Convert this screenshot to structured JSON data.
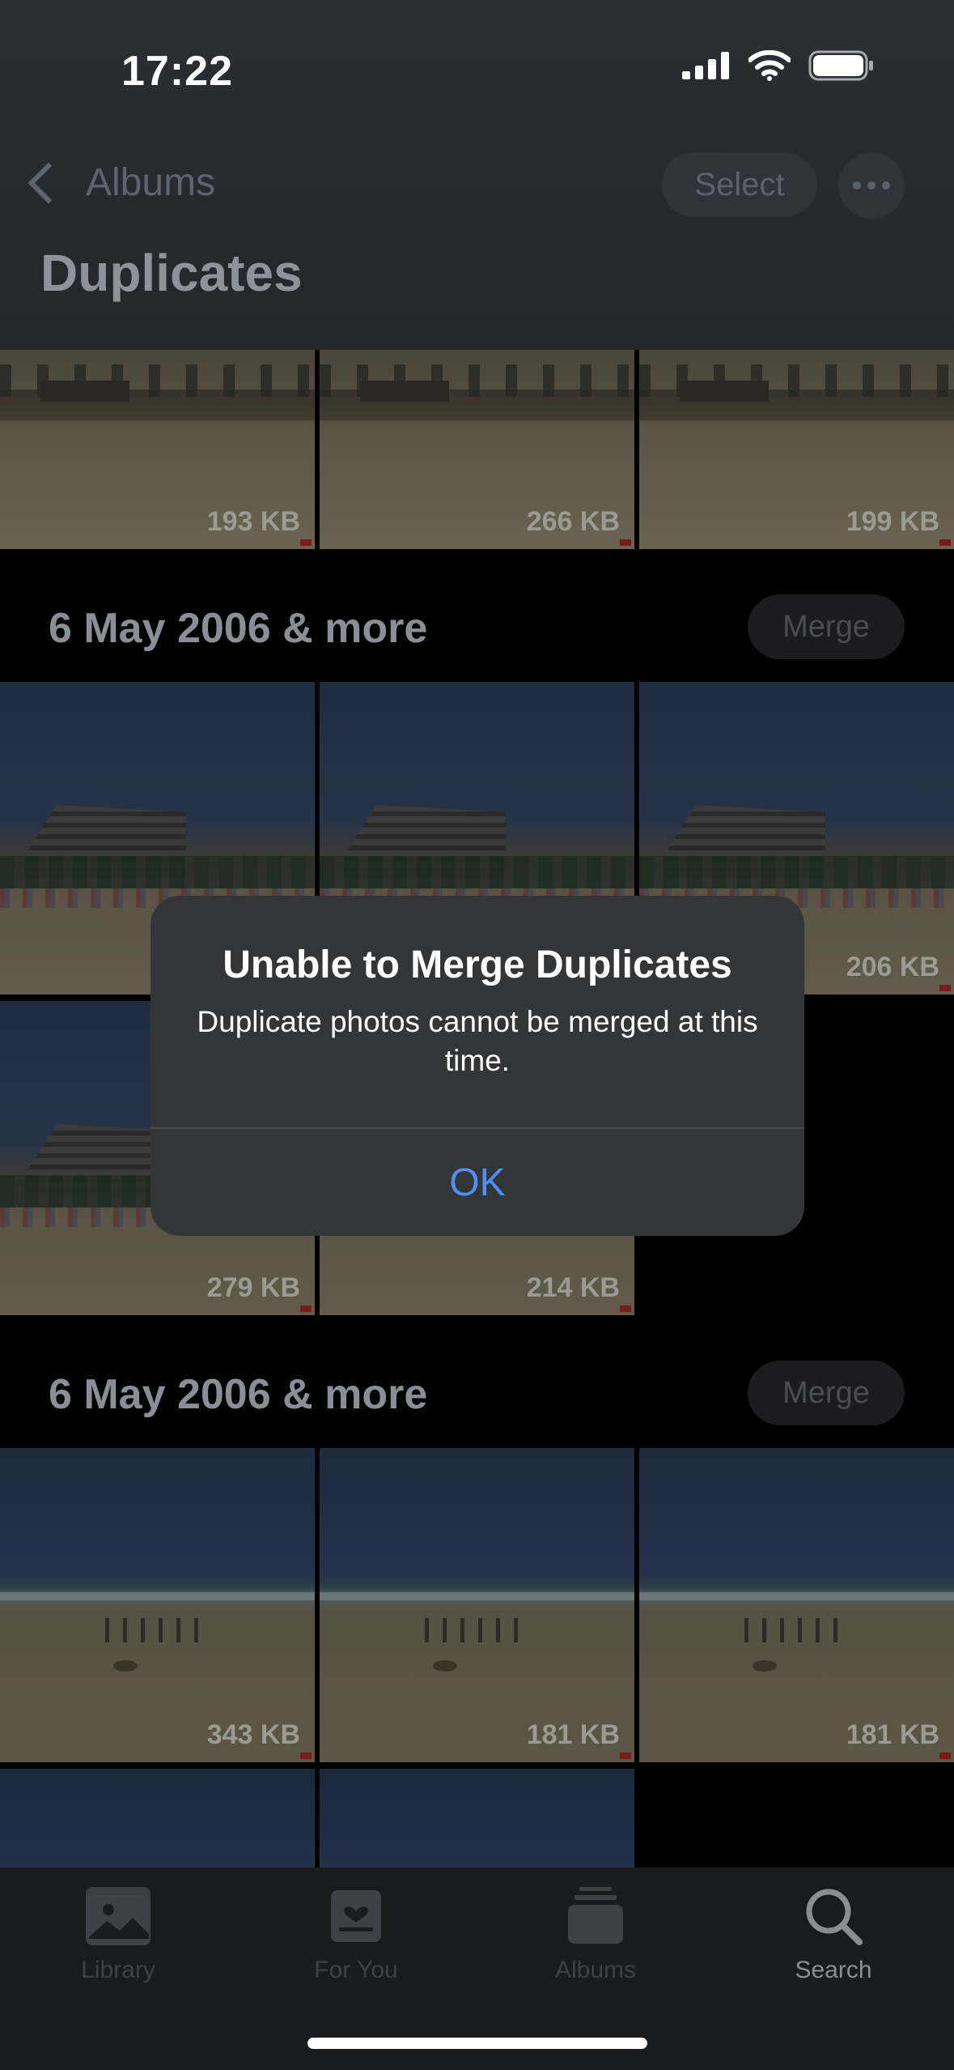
{
  "status_bar": {
    "time": "17:22"
  },
  "nav": {
    "back_label": "Albums",
    "select_label": "Select"
  },
  "page": {
    "title": "Duplicates"
  },
  "sections": [
    {
      "tiles": [
        {
          "size": "193 KB"
        },
        {
          "size": "266 KB"
        },
        {
          "size": "199 KB"
        }
      ]
    },
    {
      "title": "6 May 2006 & more",
      "merge_label": "Merge",
      "tiles": [
        {
          "size": "206 KB"
        },
        {
          "size": "279 KB"
        },
        {
          "size": "214 KB"
        }
      ]
    },
    {
      "title": "6 May 2006 & more",
      "merge_label": "Merge",
      "tiles": [
        {
          "size": "343 KB"
        },
        {
          "size": "181 KB"
        },
        {
          "size": "181 KB"
        }
      ]
    }
  ],
  "alert": {
    "title": "Unable to Merge Duplicates",
    "message": "Duplicate photos cannot be merged at this time.",
    "ok_label": "OK"
  },
  "tabbar": {
    "items": [
      {
        "label": "Library",
        "icon": "photo-icon"
      },
      {
        "label": "For You",
        "icon": "for-you-icon"
      },
      {
        "label": "Albums",
        "icon": "albums-icon"
      },
      {
        "label": "Search",
        "icon": "search-icon",
        "active": true
      }
    ]
  },
  "colors": {
    "alert_button": "#4f8ef7",
    "alert_background": "#343537"
  }
}
